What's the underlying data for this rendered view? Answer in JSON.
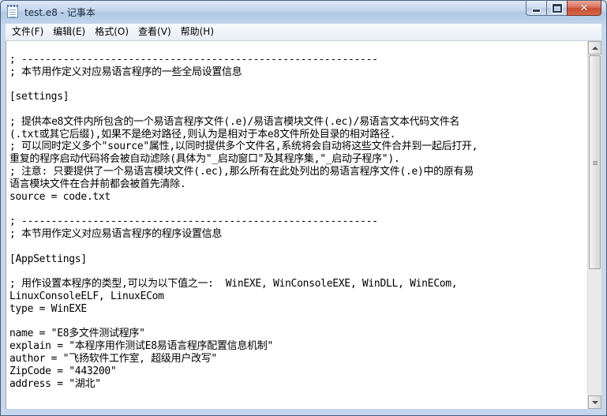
{
  "window": {
    "title": "test.e8 - 记事本",
    "buttons": {
      "minimize": "minimize-icon",
      "maximize": "maximize-icon",
      "close": "close-icon"
    }
  },
  "menu": [
    {
      "label": "文件(F)"
    },
    {
      "label": "编辑(E)"
    },
    {
      "label": "格式(O)"
    },
    {
      "label": "查看(V)"
    },
    {
      "label": "帮助(H)"
    }
  ],
  "editor": {
    "lines": [
      "",
      "; ------------------------------------------------------------",
      "; 本节用作定义对应易语言程序的一些全局设置信息",
      "",
      "[settings]",
      "",
      "; 提供本e8文件内所包含的一个易语言程序文件(.e)/易语言模块文件(.ec)/易语言文本代码文件名",
      "(.txt或其它后缀),如果不是绝对路径,则认为是相对于本e8文件所处目录的相对路径.",
      "; 可以同时定义多个\"source\"属性,以同时提供多个文件名,系统将会自动将这些文件合并到一起后打开,",
      "重复的程序启动代码将会被自动滤除(具体为\"_启动窗口\"及其程序集,\"_启动子程序\").",
      "; 注意: 只要提供了一个易语言模块文件(.ec),那么所有在此处列出的易语言程序文件(.e)中的原有易",
      "语言模块文件在合并前都会被首先清除.",
      "source = code.txt",
      "",
      "; ------------------------------------------------------------",
      "; 本节用作定义对应易语言程序的程序设置信息",
      "",
      "[AppSettings]",
      "",
      "; 用作设置本程序的类型,可以为以下值之一:  WinEXE, WinConsoleEXE, WinDLL, WinECom,",
      "LinuxConsoleELF, LinuxECom",
      "type = WinEXE",
      "",
      "name = \"E8多文件测试程序\"",
      "explain = \"本程序用作测试E8易语言程序配置信息机制\"",
      "author = \"飞扬软件工作室, 超级用户改写\"",
      "ZipCode = \"443200\"",
      "address = \"湖北\""
    ]
  },
  "scrollbar": {
    "position_fraction": 0.0,
    "visible_fraction": 0.63
  }
}
